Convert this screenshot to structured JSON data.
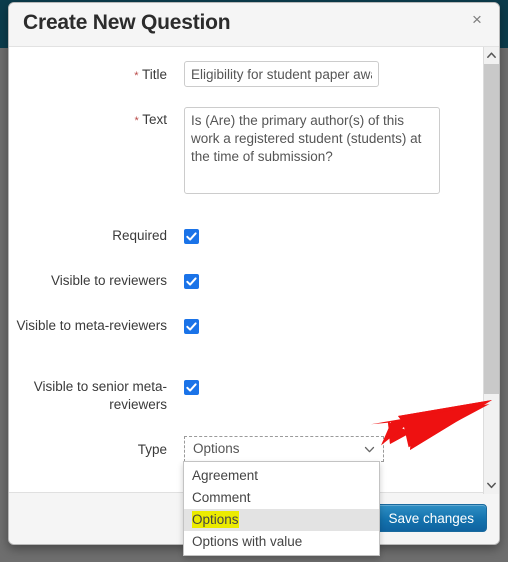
{
  "modal": {
    "title": "Create New Question",
    "close_icon": "close-icon",
    "close_label": "×"
  },
  "form": {
    "title_field": {
      "label": "Title",
      "required_marker": "*",
      "value": "Eligibility for student paper awar",
      "placeholder": ""
    },
    "text_field": {
      "label": "Text",
      "required_marker": "*",
      "value": "Is (Are) the primary author(s) of this work a registered student (students) at the time of submission?",
      "placeholder": ""
    },
    "checkboxes": [
      {
        "label": "Required",
        "checked": true
      },
      {
        "label": "Visible to reviewers",
        "checked": true
      },
      {
        "label": "Visible to meta-reviewers",
        "checked": true
      },
      {
        "label": "Visible to senior meta-reviewers",
        "checked": true
      }
    ],
    "type_field": {
      "label": "Type",
      "selected": "Options",
      "chevron_icon": "chevron-down-icon",
      "options": [
        {
          "label": "Agreement",
          "selected": false,
          "highlighted": false
        },
        {
          "label": "Comment",
          "selected": false,
          "highlighted": false
        },
        {
          "label": "Options",
          "selected": true,
          "highlighted": true
        },
        {
          "label": "Options with value",
          "selected": false,
          "highlighted": false
        }
      ]
    }
  },
  "footer": {
    "save_label": "Save changes"
  },
  "scrollbar": {
    "up_icon": "chevron-up-icon",
    "down_icon": "chevron-down-icon"
  },
  "annotation": {
    "arrow_color": "#ee1111",
    "points_at": "type-select-chevron"
  },
  "colors": {
    "checkbox": "#1a73e8",
    "highlight": "#ebeb00",
    "primary_button": "#1473ae",
    "page_background": "#0b3c4c",
    "required_star": "#b94a48"
  }
}
